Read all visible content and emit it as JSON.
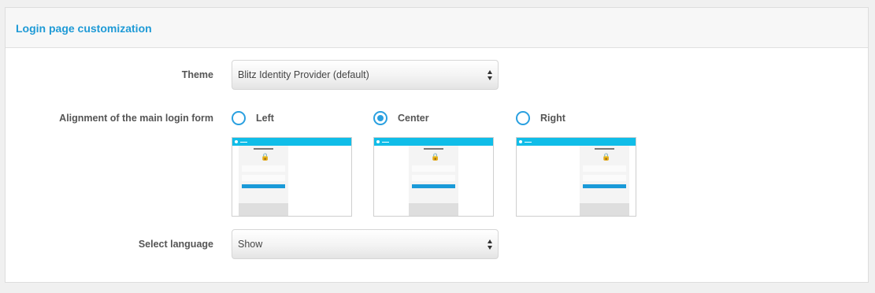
{
  "panel": {
    "title": "Login page customization"
  },
  "theme": {
    "label": "Theme",
    "selected": "Blitz Identity Provider (default)"
  },
  "alignment": {
    "label": "Alignment of the main login form",
    "options": [
      {
        "label": "Left",
        "checked": false
      },
      {
        "label": "Center",
        "checked": true
      },
      {
        "label": "Right",
        "checked": false
      }
    ]
  },
  "language": {
    "label": "Select language",
    "selected": "Show"
  },
  "icons": {
    "select_arrows": "chevron-up-down-icon",
    "lock": "lock-icon"
  },
  "colors": {
    "accent": "#1e9ad6",
    "thumb_bar": "#10bde8",
    "lock": "#f05a1e"
  }
}
